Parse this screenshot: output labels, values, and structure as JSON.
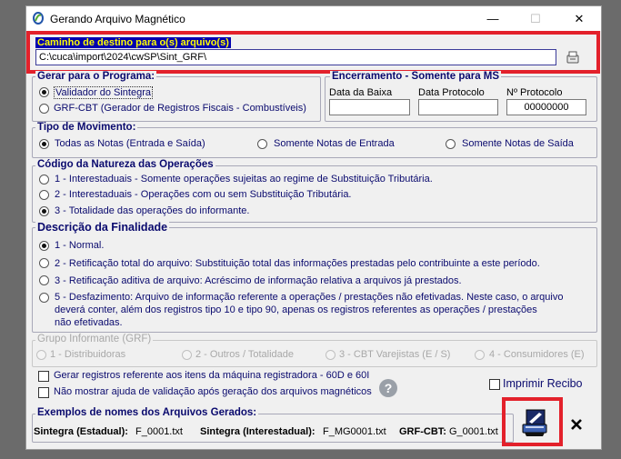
{
  "window": {
    "title": "Gerando Arquivo Magnético",
    "minimize": "—",
    "maximize": "☐",
    "close": "✕"
  },
  "destination": {
    "label": "Caminho de destino para o(s) arquivo(s)",
    "path": "C:\\cuca\\import\\2024\\cwSP\\Sint_GRF\\"
  },
  "program": {
    "title": "Gerar para o Programa:",
    "options": [
      {
        "label": "Validador do Sintegra",
        "selected": true
      },
      {
        "label": "GRF-CBT (Gerador de Registros Fiscais - Combustíveis)",
        "selected": false
      }
    ]
  },
  "closing": {
    "title": "Encerramento - Somente para MS",
    "fields": [
      {
        "label": "Data da Baixa",
        "value": ""
      },
      {
        "label": "Data Protocolo",
        "value": ""
      },
      {
        "label": "Nº Protocolo",
        "value": "00000000"
      }
    ]
  },
  "movement": {
    "title": "Tipo de Movimento:",
    "options": [
      {
        "label": "Todas as Notas (Entrada e Saída)",
        "selected": true
      },
      {
        "label": "Somente Notas de Entrada",
        "selected": false
      },
      {
        "label": "Somente Notas de Saída",
        "selected": false
      }
    ]
  },
  "nature": {
    "title": "Código da Natureza das Operações",
    "options": [
      {
        "label": "1 - Interestaduais - Somente operações sujeitas ao regime de Substituição Tributária.",
        "selected": false
      },
      {
        "label": "2 - Interestaduais - Operações com ou sem Substituição Tributária.",
        "selected": false
      },
      {
        "label": "3 - Totalidade das operações do informante.",
        "selected": true
      }
    ]
  },
  "purpose": {
    "title": "Descrição da Finalidade",
    "options": [
      {
        "label": "1 - Normal.",
        "selected": true
      },
      {
        "label": "2 - Retificação  total do arquivo:  Substituição  total das  informações  prestadas  pelo contribuinte a este período.",
        "selected": false
      },
      {
        "label": "3 - Retificação aditiva de arquivo: Acréscimo de informação relativa a arquivos já prestados.",
        "selected": false
      },
      {
        "label": "5 - Desfazimento:  Arquivo  de  informação  referente  a  operações / prestações  não  efetivadas.  Neste  caso,  o  arquivo",
        "line2": "deverá   conter,   além  dos   registros   tipo 10 e tipo 90,   apenas  os registros   referentes  as   operações / prestações",
        "line3": "não efetivadas.",
        "selected": false
      }
    ]
  },
  "grf_group": {
    "title": "Grupo Informante (GRF)",
    "options": [
      {
        "label": "1 - Distribuidoras"
      },
      {
        "label": "2 - Outros / Totalidade"
      },
      {
        "label": "3 - CBT Varejistas (E / S)"
      },
      {
        "label": "4 - Consumidores (E)"
      }
    ]
  },
  "options": {
    "register_machine": "Gerar registros referente aos itens da máquina registradora - 60D e 60I",
    "no_help": "Não mostrar ajuda de validação após geração dos arquivos magnéticos",
    "print_receipt": "Imprimir Recibo",
    "help_glyph": "?"
  },
  "examples": {
    "title": "Exemplos de nomes dos Arquivos Gerados:",
    "items": [
      {
        "label": "Sintegra (Estadual):",
        "value": "F_0001.txt"
      },
      {
        "label": "Sintegra (Interestadual):",
        "value": "F_MG0001.txt"
      },
      {
        "label": "GRF-CBT:",
        "value": "G_0001.txt"
      }
    ]
  },
  "colors": {
    "highlight": "#e3212b",
    "destination_label": "#ffff00",
    "destination_bg": "#0000b0",
    "text": "#0a0a6e"
  }
}
